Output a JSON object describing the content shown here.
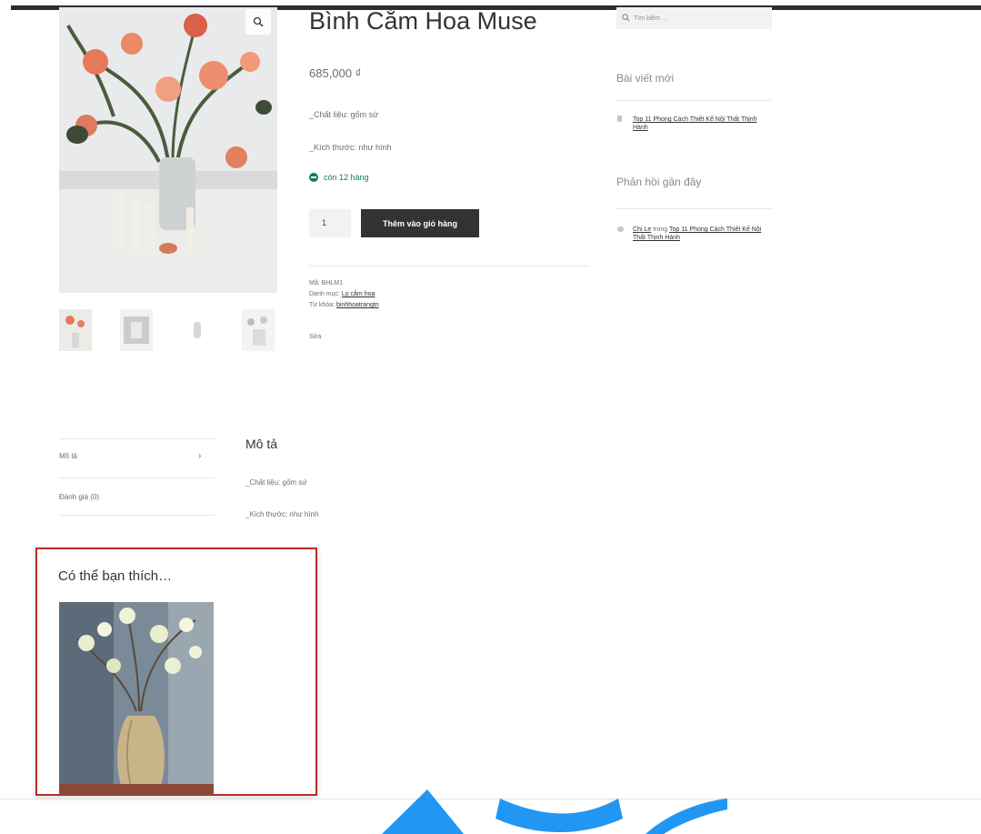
{
  "product": {
    "title": "Bình Cắm Hoa Muse",
    "price": "685,000 ₫",
    "material": "_Chất liệu: gốm sứ",
    "size": "_Kích thước: như hình",
    "stock": "còn 12 hàng",
    "quantity": "1",
    "add_to_cart": "Thêm vào giỏ hàng",
    "sku_label": "Mã:",
    "sku": "BHLM1",
    "category_label": "Danh mục:",
    "category": "Lọ cắm hoa",
    "tag_label": "Từ khóa:",
    "tag": "binhhoatrangtri",
    "edit": "Sửa"
  },
  "sidebar": {
    "search_placeholder": "Tìm kiếm ...",
    "recent_posts_title": "Bài viết mới",
    "recent_post": "Top 11 Phong Cách Thiết Kế Nội Thất Thịnh Hành",
    "recent_comments_title": "Phản hồi gần đây",
    "comment_author": "Chi Le",
    "comment_on": "trong",
    "comment_post": "Top 11 Phong Cách Thiết Kế Nội Thất Thịnh Hành"
  },
  "tabs": {
    "description": "Mô tả",
    "reviews": "Đánh giá (0)",
    "panel_title": "Mô tả",
    "panel_material": "_Chất liệu: gốm sứ",
    "panel_size": "_Kích thước: như hình"
  },
  "related": {
    "title": "Có thể bạn thích…"
  },
  "colors": {
    "button": "#333333",
    "stock": "#0f834d",
    "highlight_border": "#b82b2b",
    "watermark": "#2196f3"
  }
}
